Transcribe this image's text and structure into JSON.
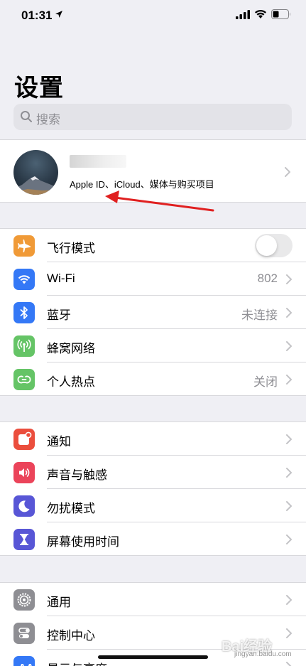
{
  "status_bar": {
    "time": "01:31"
  },
  "title": "设置",
  "search": {
    "placeholder": "搜索"
  },
  "profile": {
    "name": "█████",
    "subtitle": "Apple ID、iCloud、媒体与购买项目"
  },
  "group1": [
    {
      "label": "飞行模式",
      "icon": "airplane-icon",
      "color": "#f09a37",
      "toggle": false
    },
    {
      "label": "Wi-Fi",
      "value": "802",
      "icon": "wifi-icon",
      "color": "#3478f6"
    },
    {
      "label": "蓝牙",
      "value": "未连接",
      "icon": "bluetooth-icon",
      "color": "#3478f6"
    },
    {
      "label": "蜂窝网络",
      "icon": "cellular-icon",
      "color": "#65c466"
    },
    {
      "label": "个人热点",
      "value": "关闭",
      "icon": "hotspot-icon",
      "color": "#65c466"
    }
  ],
  "group2": [
    {
      "label": "通知",
      "icon": "notifications-icon",
      "color": "#eb4e3d"
    },
    {
      "label": "声音与触感",
      "icon": "sound-icon",
      "color": "#eb445a"
    },
    {
      "label": "勿扰模式",
      "icon": "moon-icon",
      "color": "#5856d6"
    },
    {
      "label": "屏幕使用时间",
      "icon": "hourglass-icon",
      "color": "#5856d6"
    }
  ],
  "group3": [
    {
      "label": "通用",
      "icon": "gear-icon",
      "color": "#8e8e93"
    },
    {
      "label": "控制中心",
      "icon": "control-center-icon",
      "color": "#8e8e93"
    },
    {
      "label": "显示与亮度",
      "icon": "display-icon",
      "color": "#3478f6"
    }
  ],
  "watermark": {
    "text": "Bai经验",
    "sub": "jingyan.baidu.com"
  }
}
